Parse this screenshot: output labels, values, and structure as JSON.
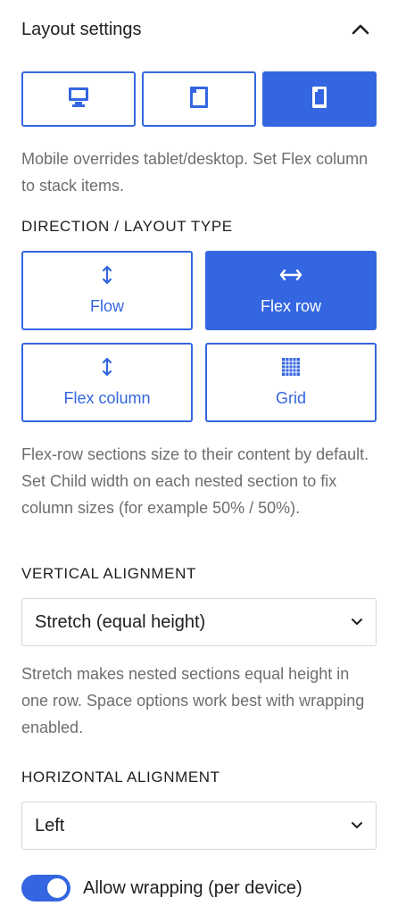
{
  "panel": {
    "title": "Layout settings"
  },
  "devices": [
    {
      "name": "desktop",
      "icon": "desktop-icon",
      "active": false
    },
    {
      "name": "tablet",
      "icon": "tablet-icon",
      "active": false
    },
    {
      "name": "mobile",
      "icon": "mobile-icon",
      "active": true
    }
  ],
  "device_help": "Mobile overrides tablet/desktop. Set Flex column to stack items.",
  "direction": {
    "label": "DIRECTION / LAYOUT TYPE",
    "options": [
      {
        "label": "Flow",
        "icon": "vertical-arrows-icon",
        "active": false
      },
      {
        "label": "Flex row",
        "icon": "horizontal-arrows-icon",
        "active": true
      },
      {
        "label": "Flex column",
        "icon": "vertical-arrows-icon",
        "active": false
      },
      {
        "label": "Grid",
        "icon": "grid-icon",
        "active": false
      }
    ],
    "help": "Flex-row sections size to their content by default. Set Child width on each nested section to fix column sizes (for example 50% / 50%)."
  },
  "vertical_alignment": {
    "label": "VERTICAL ALIGNMENT",
    "value": "Stretch (equal height)",
    "help": "Stretch makes nested sections equal height in one row. Space options work best with wrapping enabled."
  },
  "horizontal_alignment": {
    "label": "HORIZONTAL ALIGNMENT",
    "value": "Left"
  },
  "wrapping": {
    "label": "Allow wrapping (per device)",
    "enabled": true
  },
  "colors": {
    "accent": "#3366e0",
    "muted_text": "#6e6e6e",
    "border": "#d6d6d6"
  }
}
